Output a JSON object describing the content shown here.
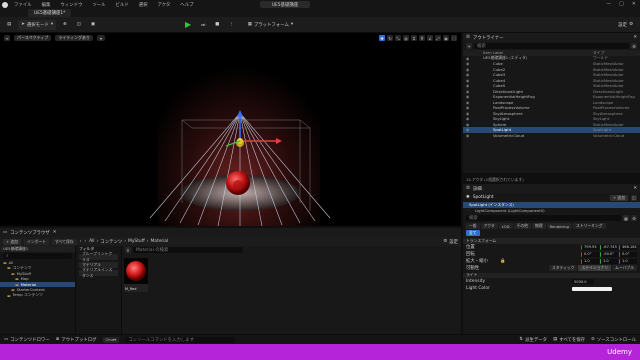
{
  "menu": {
    "items": [
      "ファイル",
      "編集",
      "ウィンドウ",
      "ツール",
      "ビルド",
      "選択",
      "アクタ",
      "ヘルプ"
    ]
  },
  "project_title": "UE5基礎講座",
  "doc_tab": "UE5基礎講座1*",
  "toolbar": {
    "save": "",
    "select_mode": "選択モード",
    "platform": "プラットフォーム",
    "settings": "設定"
  },
  "viewport": {
    "perspective": "パースペクティブ",
    "lighting": "ライティングあり"
  },
  "outliner": {
    "title": "アウトライナー",
    "search_placeholder": "検索",
    "col_label": "Item Label",
    "col_type": "タイプ",
    "rows": [
      {
        "label": "UE5基礎講座1 (エディタ)",
        "type": "ワールド",
        "indent": 0,
        "sel": false
      },
      {
        "label": "Cube",
        "type": "StaticMeshActor",
        "indent": 1,
        "sel": false
      },
      {
        "label": "Cube2",
        "type": "StaticMeshActor",
        "indent": 1,
        "sel": false
      },
      {
        "label": "Cube3",
        "type": "StaticMeshActor",
        "indent": 1,
        "sel": false
      },
      {
        "label": "Cube4",
        "type": "StaticMeshActor",
        "indent": 1,
        "sel": false
      },
      {
        "label": "Cube5",
        "type": "StaticMeshActor",
        "indent": 1,
        "sel": false
      },
      {
        "label": "DirectionalLight",
        "type": "DirectionalLight",
        "indent": 1,
        "sel": false
      },
      {
        "label": "ExponentialHeightFog",
        "type": "ExponentialHeightFog",
        "indent": 1,
        "sel": false
      },
      {
        "label": "Landscape",
        "type": "Landscape",
        "indent": 1,
        "sel": false
      },
      {
        "label": "PostProcessVolume",
        "type": "PostProcessVolume",
        "indent": 1,
        "sel": false
      },
      {
        "label": "SkyAtmosphere",
        "type": "SkyAtmosphere",
        "indent": 1,
        "sel": false
      },
      {
        "label": "SkyLight",
        "type": "SkyLight",
        "indent": 1,
        "sel": false
      },
      {
        "label": "Sphere",
        "type": "StaticMeshActor",
        "indent": 1,
        "sel": false
      },
      {
        "label": "SpotLight",
        "type": "SpotLight",
        "indent": 1,
        "sel": true
      },
      {
        "label": "VolumetricCloud",
        "type": "VolumetricCloud",
        "indent": 1,
        "sel": false
      }
    ],
    "footer": "14 アクタ (1個選択されています)"
  },
  "details": {
    "title": "詳細",
    "actor_name": "SpotLight",
    "add_button": "+ 追加",
    "component_root": "SpotLight (インスタンス)",
    "component_child": "LightComponent (LightComponent0)",
    "search_placeholder": "検索",
    "tabs": [
      "一般",
      "アクタ",
      "LOD",
      "その他",
      "物理",
      "Rendering",
      "ストリーミング"
    ],
    "all_tab": "全て",
    "section_transform": "トランスフォーム",
    "location_label": "位置",
    "rotation_label": "回転",
    "scale_label": "拡大・縮小",
    "location": [
      "799.93",
      "-67.745",
      "366.181"
    ],
    "rotation": [
      "0.0°",
      "-90.0°",
      "0.0°"
    ],
    "scale": [
      "1.0",
      "1.0",
      "1.0"
    ],
    "mobility_label": "可動性",
    "mobility_options": [
      "スタティック",
      "ステイショナリ",
      "ムーバブル"
    ],
    "section_light": "ライト",
    "intensity_label": "Intensity",
    "intensity_value": "5000.0",
    "light_color_label": "Light Color"
  },
  "content_browser": {
    "title": "コンテンツブラウザ",
    "add": "+ 追加",
    "import": "インポート",
    "save_all": "すべて保存",
    "path": [
      "All",
      "コンテンツ",
      "MyStuff",
      "Material"
    ],
    "settings": "設定",
    "project_label": "UE5基礎講座1",
    "tree": [
      "All",
      "コンテンツ",
      "MyStuff",
      "Map",
      "Material",
      "StarterContent",
      "Temp コンテンツ"
    ],
    "filters_title": "フィルタ",
    "filter_items": [
      "ブループリントクラス",
      "マテリアル",
      "マテリアルインスタンス"
    ],
    "search_placeholder": "Material の検索",
    "asset_name": "M_Red",
    "item_count": "1アイテム",
    "collections": "コレクション"
  },
  "statusbar": {
    "content_drawer": "コンテンツドロワー",
    "output_log": "アウトプットログ",
    "cmd": "Cmd",
    "cmd_placeholder": "コンソールコマンドを入力します",
    "derived_data": "派生データ",
    "save_all": "すべてを保存",
    "source_control": "ソースコントロール"
  },
  "brand": "Udemy",
  "colors": {
    "selection": "#264a75",
    "accent_blue": "#2f6fd0",
    "brand": "#b524d9",
    "play_green": "#3fbf3f"
  }
}
